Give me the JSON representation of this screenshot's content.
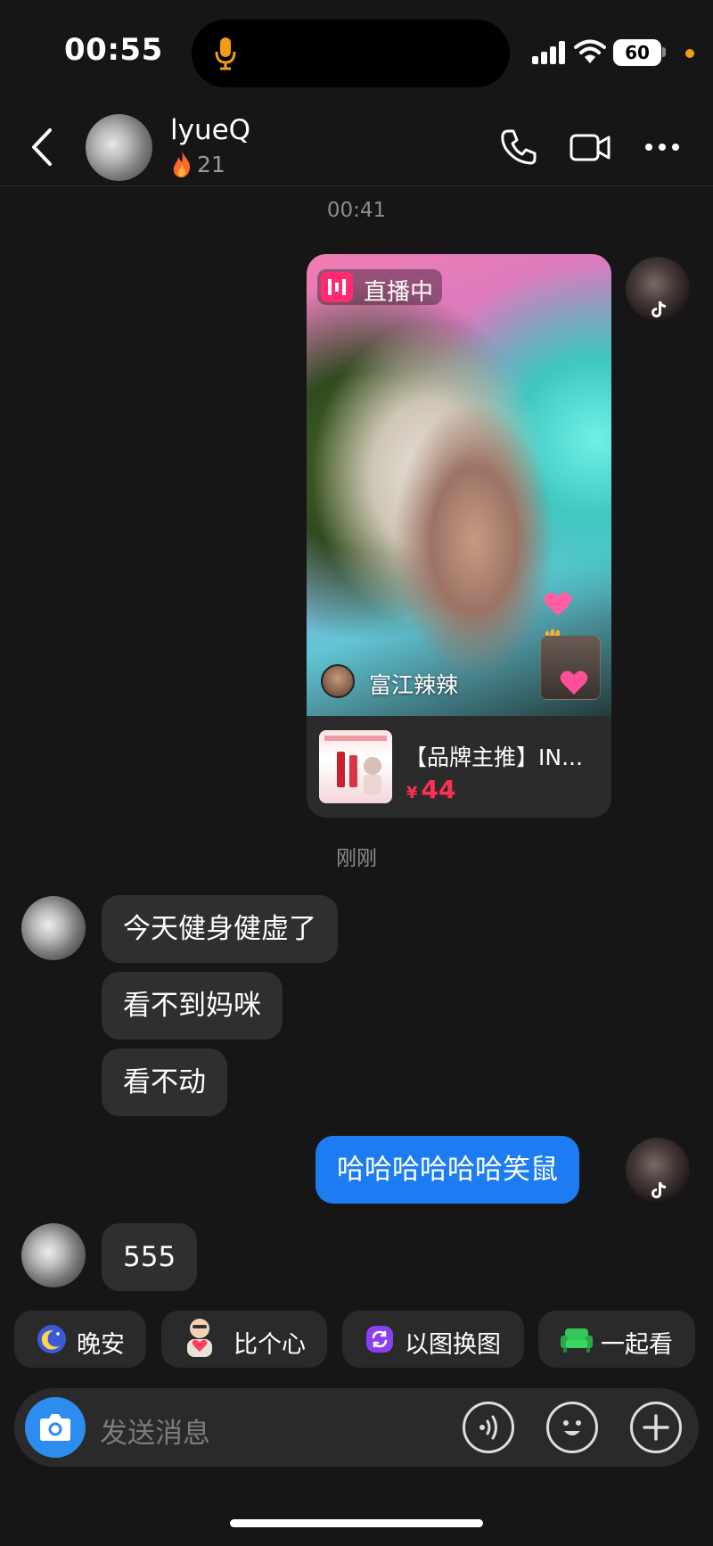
{
  "status_bar": {
    "time": "00:55",
    "battery": "60"
  },
  "header": {
    "contact_name": "lyueQ",
    "streak_count": "21"
  },
  "chat": {
    "timestamp_1": "00:41",
    "shared_live": {
      "badge": "直播中",
      "streamer_name": "富江辣辣",
      "product_title": "【品牌主推】IN...",
      "price_symbol": "¥",
      "price_value": "44"
    },
    "timestamp_2": "刚刚",
    "messages": [
      {
        "from": "friend",
        "text": "今天健身健虚了"
      },
      {
        "from": "friend",
        "text": "看不到妈咪"
      },
      {
        "from": "friend",
        "text": "看不动"
      },
      {
        "from": "me",
        "text": "哈哈哈哈哈哈笑鼠"
      },
      {
        "from": "friend",
        "text": "555"
      }
    ]
  },
  "quick_actions": [
    {
      "label": "晚安",
      "icon": "moon-icon"
    },
    {
      "label": "比个心",
      "icon": "heart-gesture-icon"
    },
    {
      "label": "以图换图",
      "icon": "swap-image-icon"
    },
    {
      "label": "一起看",
      "icon": "sofa-icon"
    }
  ],
  "composer": {
    "placeholder": "发送消息"
  },
  "colors": {
    "accent_blue": "#1d7cf2",
    "live_pink": "#ff2d6f",
    "price_red": "#ff2e55",
    "background": "#161616"
  }
}
